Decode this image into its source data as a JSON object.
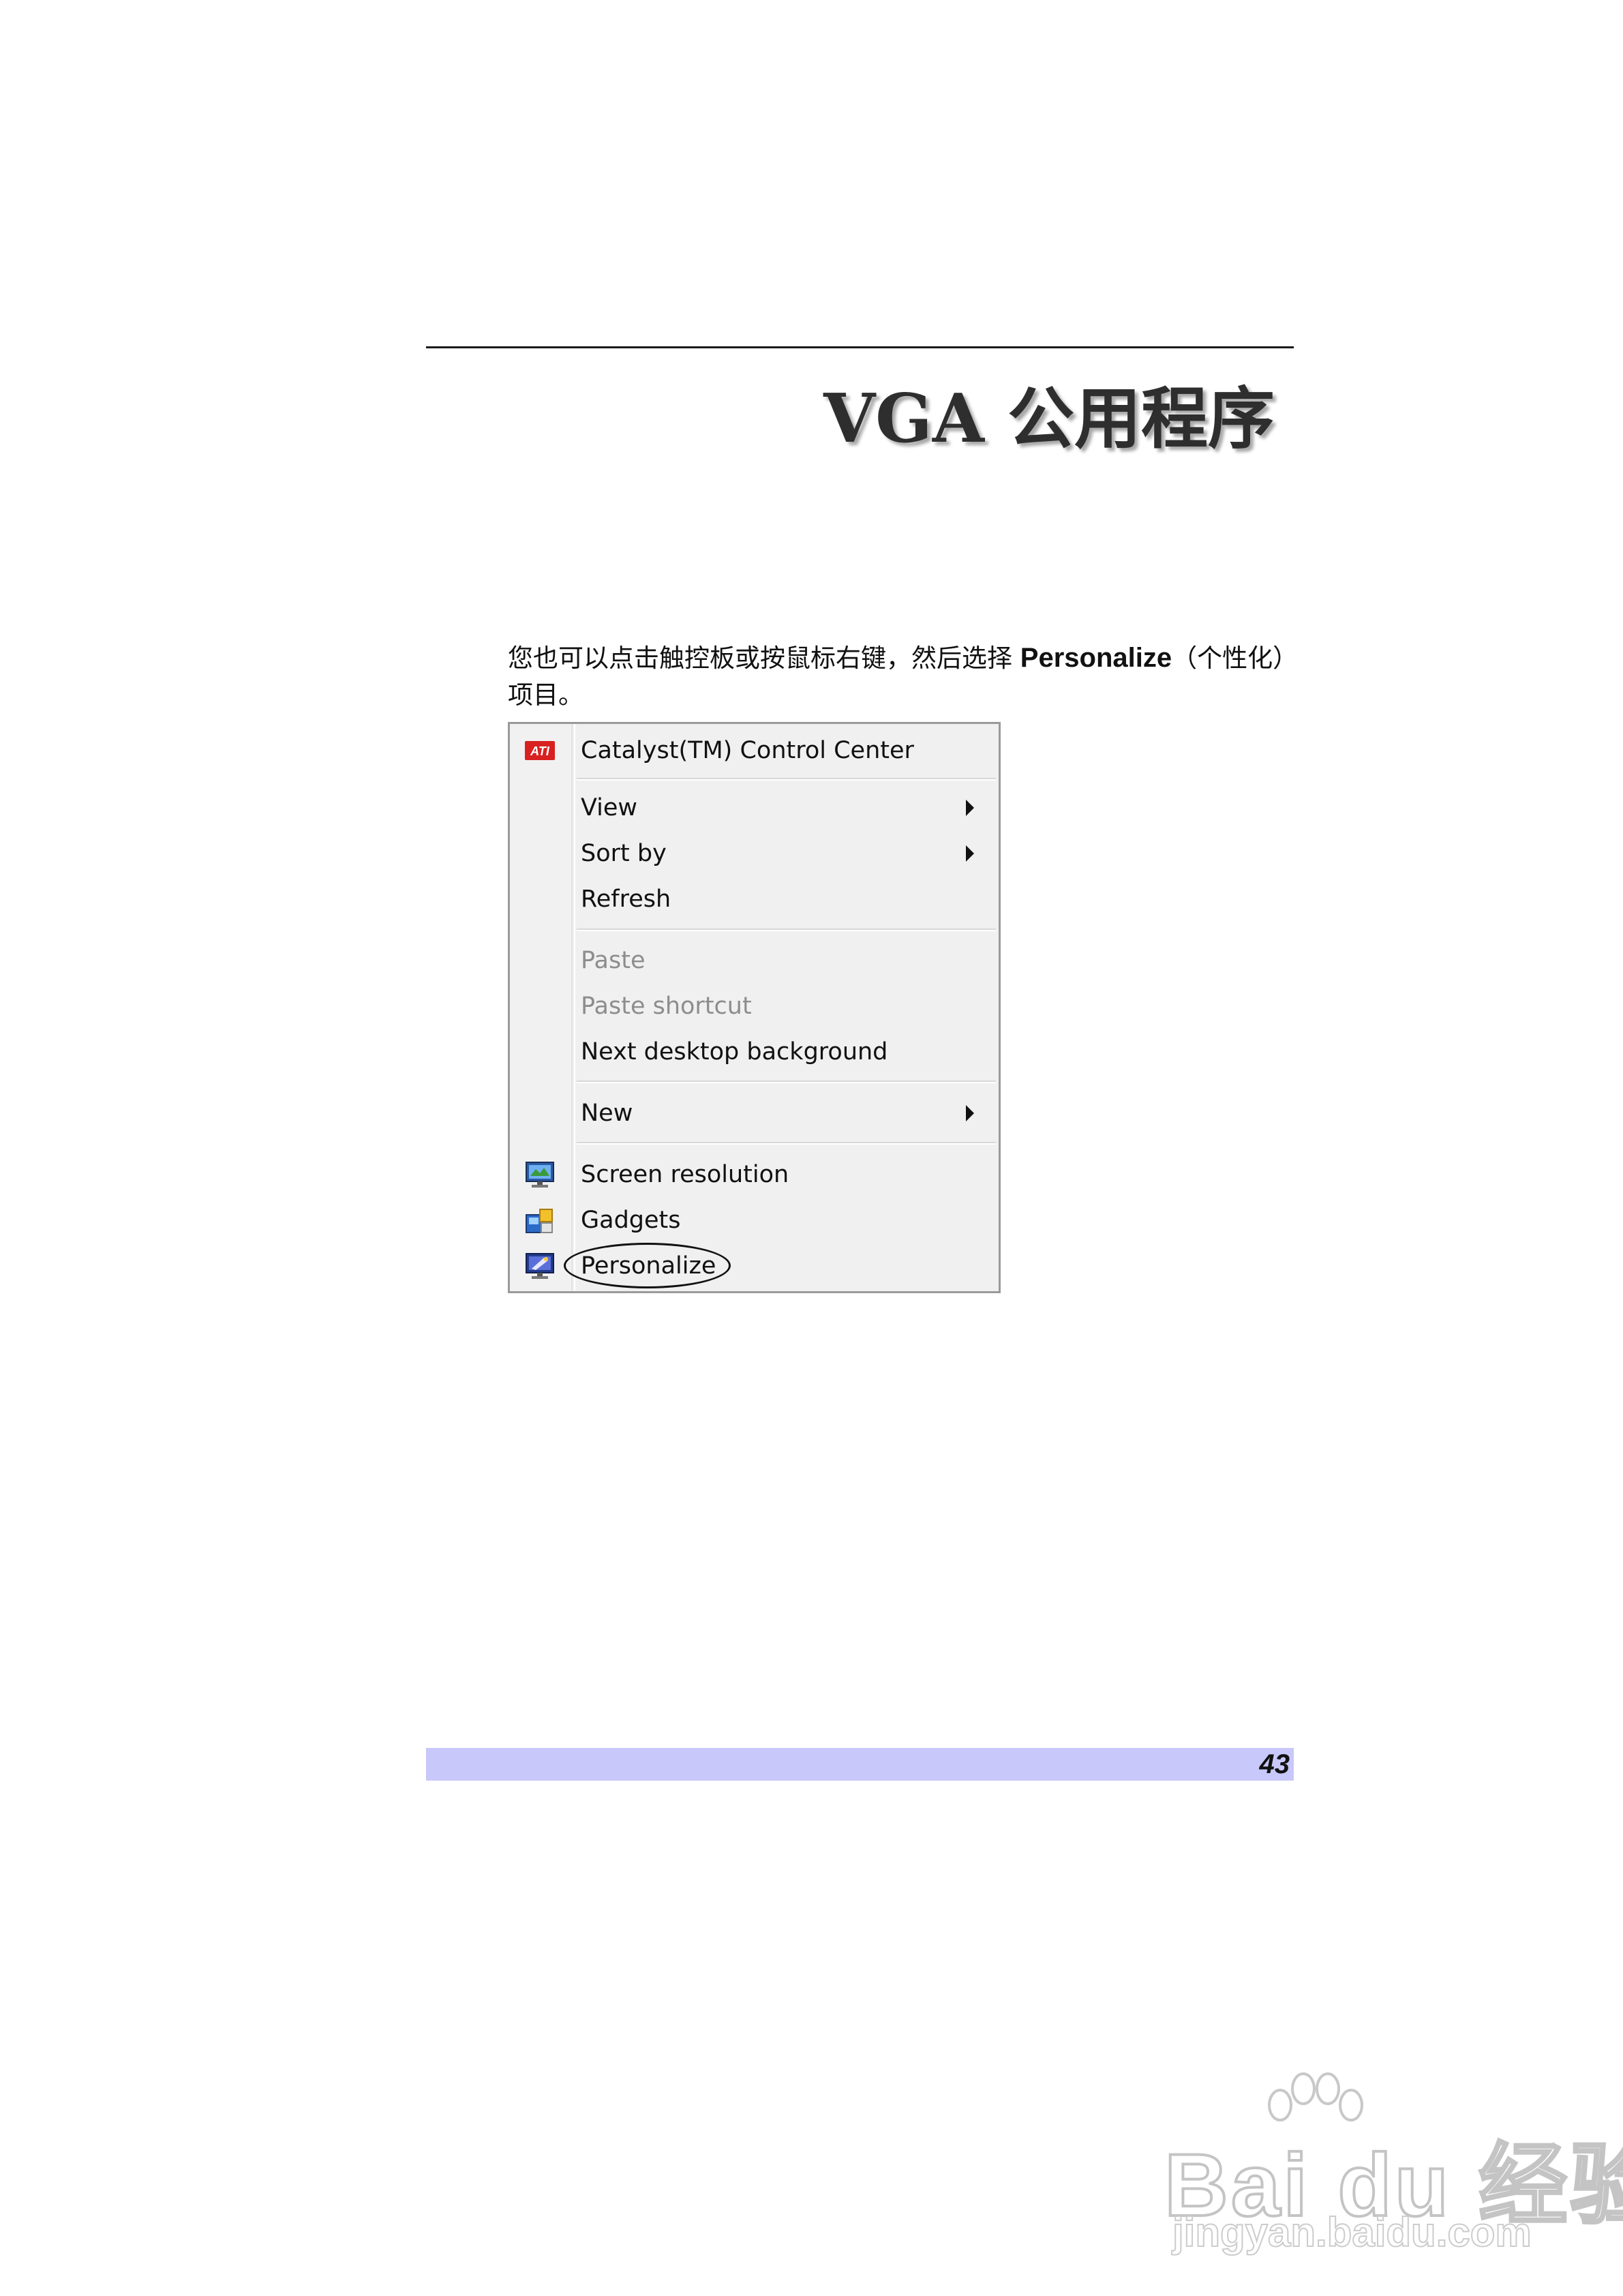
{
  "header": {
    "title": "VGA 公用程序"
  },
  "body": {
    "para_before": "您也可以点击触控板或按鼠标右键，然后选择 ",
    "para_keyword": "Personalize",
    "para_after": "（个性化）项目。"
  },
  "context_menu": {
    "items": [
      {
        "label": "Catalyst(TM) Control Center",
        "icon": "ati-icon"
      },
      {
        "label": "View",
        "submenu": true
      },
      {
        "label": "Sort by",
        "submenu": true
      },
      {
        "label": "Refresh"
      },
      {
        "label": "Paste",
        "disabled": true
      },
      {
        "label": "Paste shortcut",
        "disabled": true
      },
      {
        "label": "Next desktop background"
      },
      {
        "label": "New",
        "submenu": true
      },
      {
        "label": "Screen resolution",
        "icon": "screen-resolution-icon"
      },
      {
        "label": "Gadgets",
        "icon": "gadgets-icon"
      },
      {
        "label": "Personalize",
        "icon": "personalize-icon",
        "highlighted": true
      }
    ]
  },
  "footer": {
    "page_number": "43"
  },
  "watermark": {
    "brand": "Bai du 经验",
    "url": "jingyan.baidu.com"
  },
  "colors": {
    "footer_bar": "#c8c8fa",
    "ati_red": "#d92020"
  }
}
